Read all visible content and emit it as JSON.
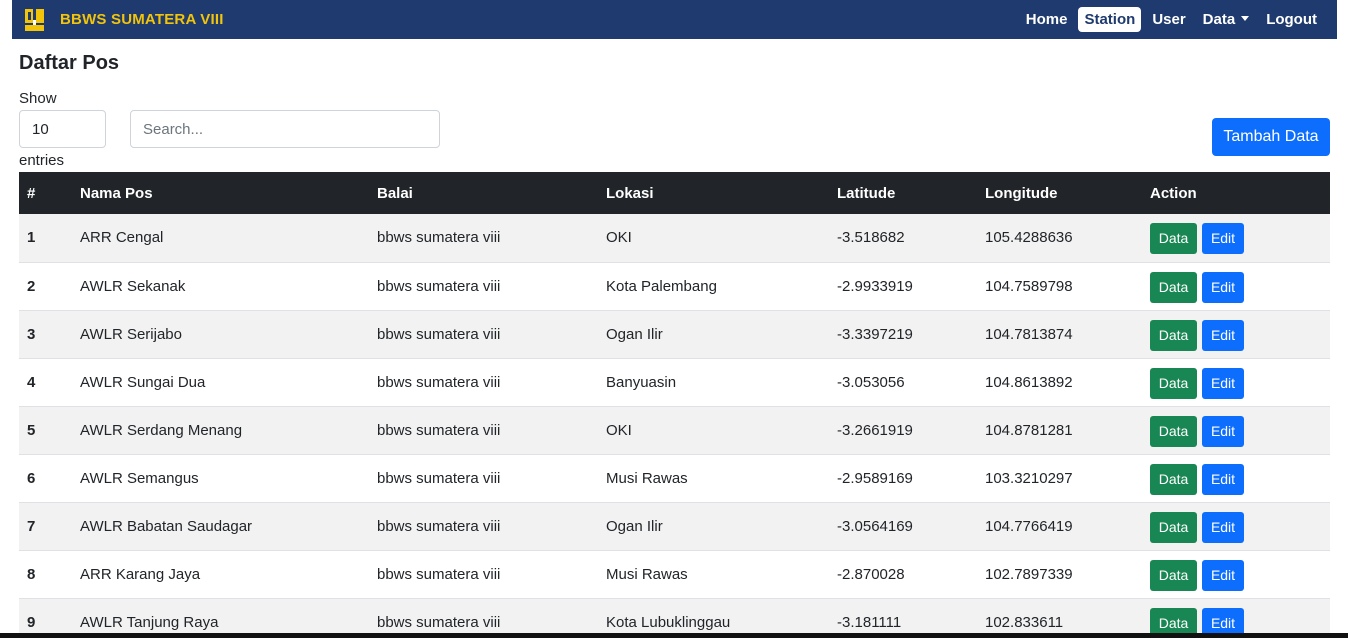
{
  "navbar": {
    "brand": "BBWS SUMATERA VIII",
    "links": [
      "Home",
      "Station",
      "User",
      "Data",
      "Logout"
    ],
    "active": "Station",
    "colors": {
      "bg": "#1f3a6e",
      "brand": "#f2c40a"
    }
  },
  "page": {
    "title": "Daftar Pos",
    "show_label": "Show",
    "entries_label": "entries",
    "length_value": "10",
    "search_placeholder": "Search...",
    "add_button": "Tambah Data"
  },
  "table": {
    "headers": [
      "#",
      "Nama Pos",
      "Balai",
      "Lokasi",
      "Latitude",
      "Longitude",
      "Action"
    ],
    "actions": {
      "data": "Data",
      "edit": "Edit"
    },
    "rows": [
      [
        "1",
        "ARR Cengal",
        "bbws sumatera viii",
        "OKI",
        "-3.518682",
        "105.4288636"
      ],
      [
        "2",
        "AWLR Sekanak",
        "bbws sumatera viii",
        "Kota Palembang",
        "-2.9933919",
        "104.7589798"
      ],
      [
        "3",
        "AWLR Serijabo",
        "bbws sumatera viii",
        "Ogan Ilir",
        "-3.3397219",
        "104.7813874"
      ],
      [
        "4",
        "AWLR Sungai Dua",
        "bbws sumatera viii",
        "Banyuasin",
        "-3.053056",
        "104.8613892"
      ],
      [
        "5",
        "AWLR Serdang Menang",
        "bbws sumatera viii",
        "OKI",
        "-3.2661919",
        "104.8781281"
      ],
      [
        "6",
        "AWLR Semangus",
        "bbws sumatera viii",
        "Musi Rawas",
        "-2.9589169",
        "103.3210297"
      ],
      [
        "7",
        "AWLR Babatan Saudagar",
        "bbws sumatera viii",
        "Ogan Ilir",
        "-3.0564169",
        "104.7766419"
      ],
      [
        "8",
        "ARR Karang Jaya",
        "bbws sumatera viii",
        "Musi Rawas",
        "-2.870028",
        "102.7897339"
      ],
      [
        "9",
        "AWLR Tanjung Raya",
        "bbws sumatera viii",
        "Kota Lubuklinggau",
        "-3.181111",
        "102.833611"
      ]
    ]
  }
}
